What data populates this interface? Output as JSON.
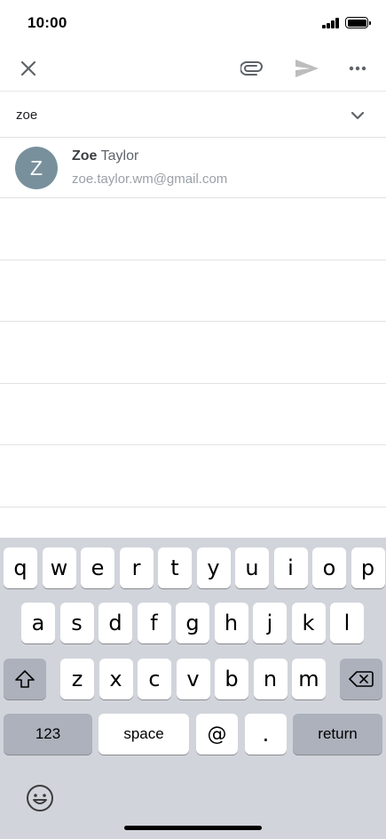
{
  "status_bar": {
    "time": "10:00"
  },
  "toolbar": {
    "close_icon": "close-icon",
    "attach_icon": "paperclip-icon",
    "send_icon": "send-icon",
    "more_icon": "more-horizontal-icon"
  },
  "to_field": {
    "value": "zoe",
    "expand_icon": "chevron-down-icon"
  },
  "suggestion": {
    "avatar_letter": "Z",
    "avatar_color": "#78909c",
    "name_match": "Zoe",
    "name_rest": " Taylor",
    "email": "zoe.taylor.wm@gmail.com"
  },
  "keyboard": {
    "row1": [
      "q",
      "w",
      "e",
      "r",
      "t",
      "y",
      "u",
      "i",
      "o",
      "p"
    ],
    "row2": [
      "a",
      "s",
      "d",
      "f",
      "g",
      "h",
      "j",
      "k",
      "l"
    ],
    "row3": [
      "z",
      "x",
      "c",
      "v",
      "b",
      "n",
      "m"
    ],
    "numbers_label": "123",
    "space_label": "space",
    "at_label": "@",
    "period_label": ".",
    "return_label": "return",
    "shift_icon": "shift-icon",
    "delete_icon": "backspace-icon",
    "emoji_icon": "emoji-icon"
  },
  "colors": {
    "keyboard_bg": "#d1d4db",
    "key_bg": "#ffffff",
    "special_key_bg": "#acb1bc"
  }
}
